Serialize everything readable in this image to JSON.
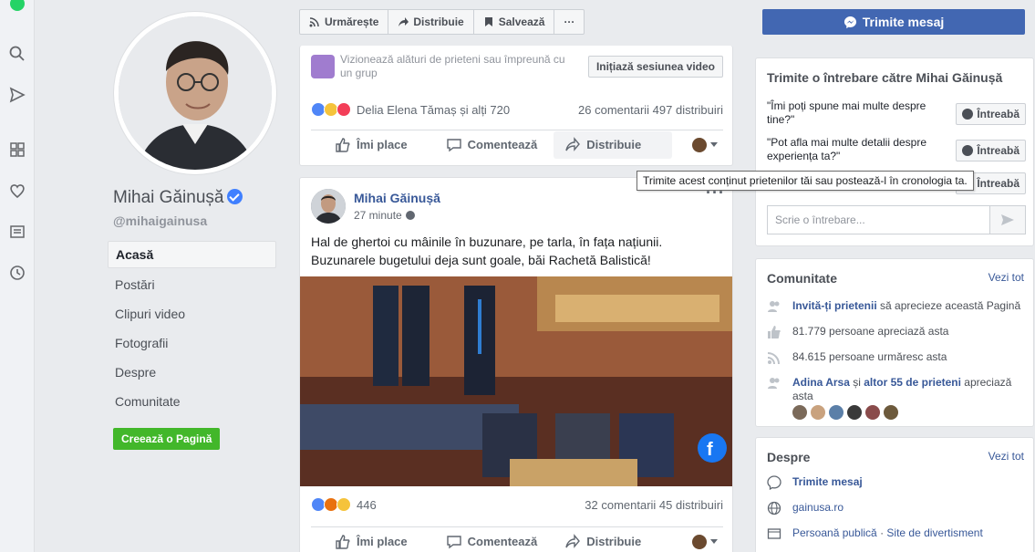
{
  "left_rail": {
    "icons": [
      "whatsapp-icon",
      "search-icon",
      "send-icon",
      "grid-icon",
      "heart-icon",
      "news-icon",
      "clock-icon"
    ]
  },
  "profile": {
    "name": "Mihai Găinușă",
    "handle": "@mihaigainusa",
    "nav": [
      "Acasă",
      "Postări",
      "Clipuri video",
      "Fotografii",
      "Despre",
      "Comunitate"
    ],
    "active_nav": "Acasă",
    "create_page": "Creează o Pagină"
  },
  "toolbar": {
    "follow": "Urmărește",
    "share": "Distribuie",
    "save": "Salvează",
    "more": "···"
  },
  "post1": {
    "watch_text": "Vizionează alături de prieteni sau împreună cu un grup",
    "watch_button": "Inițiază sesiunea video",
    "reactions_names": "Delia Elena Tămaș și alți 720",
    "stats": "26 comentarii   497 distribuiri"
  },
  "post2": {
    "author": "Mihai Găinușă",
    "time": "27 minute",
    "text_line1": "Hal de ghertoi cu mâinile în buzunare, pe tarla, în fața națiunii.",
    "text_line2": "Buzunarele bugetului deja sunt goale, băi Rachetă Balistică!",
    "reactions_count": "446",
    "stats": "32 comentarii   45 distribuiri"
  },
  "actions": {
    "like": "Îmi place",
    "comment": "Comentează",
    "share": "Distribuie"
  },
  "tooltip": "Trimite acest conținut prietenilor tăi sau postează-l în cronologia ta.",
  "right": {
    "message_button": "Trimite mesaj",
    "ask_title": "Trimite o întrebare către Mihai Găinușă",
    "questions": [
      {
        "text": "\"Îmi poți spune mai multe despre tine?\"",
        "button": "Întreabă"
      },
      {
        "text": "\"Pot afla mai multe detalii despre experiența ta?\"",
        "button": "Întreabă"
      },
      {
        "text": "",
        "button": "Întreabă"
      }
    ],
    "ask_placeholder": "Scrie o întrebare...",
    "community": {
      "title": "Comunitate",
      "see_all": "Vezi tot",
      "invite": "Invită-ți prietenii",
      "invite_rest": " să aprecieze această Pagină",
      "likes": "81.779 persoane apreciază asta",
      "follows": "84.615 persoane urmăresc asta",
      "friends_bold": "Adina Arsa",
      "friends_mid": " și ",
      "friends_bold2": "altor 55 de prieteni",
      "friends_rest": " apreciază asta"
    },
    "about": {
      "title": "Despre",
      "see_all": "Vezi tot",
      "message": "Trimite mesaj",
      "website": "gainusa.ro",
      "category1": "Persoană publică",
      "sep": " · ",
      "category2": "Site de divertisment"
    }
  },
  "colors": {
    "brand_blue": "#4267b2",
    "link_blue": "#385898",
    "green": "#42b72a"
  }
}
